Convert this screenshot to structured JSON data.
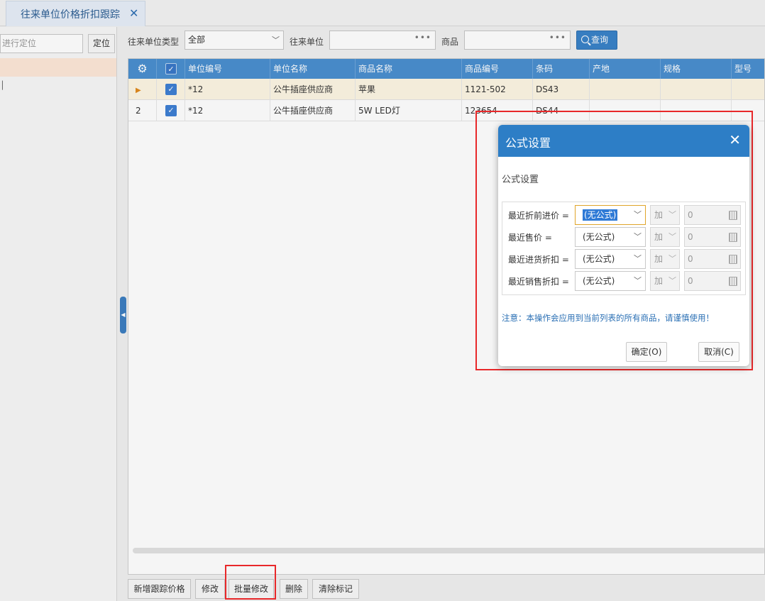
{
  "tab": {
    "title": "往来单位价格折扣跟踪",
    "close": "✕"
  },
  "left": {
    "search_placeholder": "进行定位",
    "locate": "定位",
    "row2": "│"
  },
  "filters": {
    "type_label": "往来单位类型",
    "type_value": "全部",
    "unit_label": "往来单位",
    "unit_value": "",
    "unit_dots": "•••",
    "goods_label": "商品",
    "goods_value": "",
    "goods_dots": "•••",
    "query": "查询"
  },
  "grid": {
    "columns": [
      "单位编号",
      "单位名称",
      "商品名称",
      "商品编号",
      "条码",
      "产地",
      "规格",
      "型号"
    ],
    "rows": [
      {
        "idx": "▶",
        "code": "*12",
        "name": "公牛插座供应商",
        "goods": "苹果",
        "goods_no": "1121-502",
        "barcode": "DS43",
        "origin": "",
        "spec": "",
        "model": ""
      },
      {
        "idx": "2",
        "code": "*12",
        "name": "公牛插座供应商",
        "goods": "5W LED灯",
        "goods_no": "123654",
        "barcode": "DS44",
        "origin": "",
        "spec": "",
        "model": ""
      }
    ]
  },
  "buttons": {
    "add": "新增跟踪价格",
    "edit": "修改",
    "batch_edit": "批量修改",
    "delete": "删除",
    "clear": "清除标记"
  },
  "dialog": {
    "title": "公式设置",
    "subtitle": "公式设置",
    "rows": [
      {
        "label": "最近折前进价 =",
        "formula": "(无公式)",
        "op": "加",
        "value": "0"
      },
      {
        "label": "最近售价 =",
        "formula": "(无公式)",
        "op": "加",
        "value": "0"
      },
      {
        "label": "最近进货折扣 =",
        "formula": "(无公式)",
        "op": "加",
        "value": "0"
      },
      {
        "label": "最近销售折扣 =",
        "formula": "(无公式)",
        "op": "加",
        "value": "0"
      }
    ],
    "note": "注意：本操作会应用到当前列表的所有商品，请谨慎使用！",
    "ok": "确定(O)",
    "cancel": "取消(C)"
  },
  "colors": {
    "header": "#4a8fd0",
    "dialog_header": "#2d7ec6",
    "highlight": "#e8282a"
  }
}
